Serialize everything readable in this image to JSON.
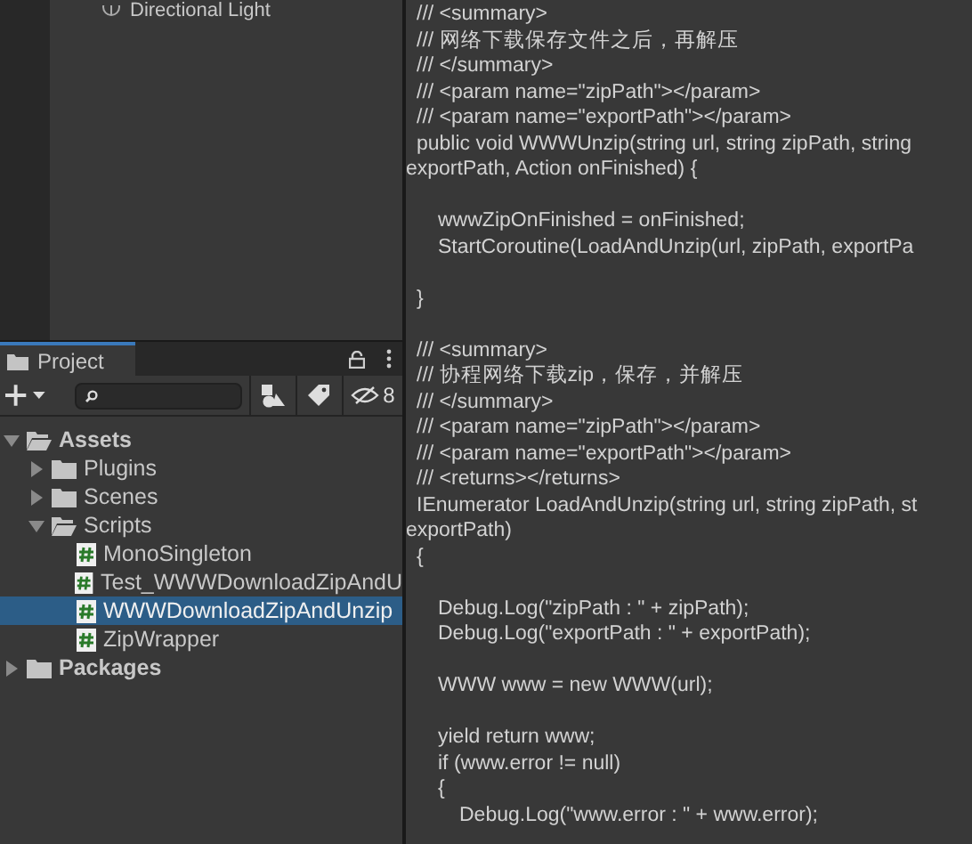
{
  "hierarchy": {
    "items": [
      {
        "label": "Directional Light"
      }
    ]
  },
  "project": {
    "tab": {
      "label": "Project",
      "selected": true
    },
    "hidden_count": "8",
    "tree": [
      {
        "kind": "folder",
        "label": "Assets",
        "expanded": true,
        "selected": false,
        "children": [
          {
            "kind": "folder",
            "label": "Plugins",
            "expanded": false,
            "selected": false
          },
          {
            "kind": "folder",
            "label": "Scenes",
            "expanded": false,
            "selected": false
          },
          {
            "kind": "folder",
            "label": "Scripts",
            "expanded": true,
            "selected": false,
            "children": [
              {
                "kind": "script",
                "label": "MonoSingleton",
                "selected": false
              },
              {
                "kind": "script",
                "label": "Test_WWWDownloadZipAndU",
                "selected": false
              },
              {
                "kind": "script",
                "label": "WWWDownloadZipAndUnzip",
                "selected": true
              },
              {
                "kind": "script",
                "label": "ZipWrapper",
                "selected": false
              }
            ]
          }
        ]
      },
      {
        "kind": "folder",
        "label": "Packages",
        "expanded": false,
        "selected": false
      }
    ]
  },
  "code": {
    "lines": [
      {
        "kind": "outer",
        "text": "/// <summary>"
      },
      {
        "kind": "outer",
        "text": "/// 网络下载保存文件之后，再解压"
      },
      {
        "kind": "outer",
        "text": "/// </summary>"
      },
      {
        "kind": "outer",
        "text": "/// <param name=\"zipPath\"></param>"
      },
      {
        "kind": "outer",
        "text": "/// <param name=\"exportPath\"></param>"
      },
      {
        "kind": "outer",
        "text": "public void WWWUnzip(string url, string zipPath, string"
      },
      {
        "kind": "wrap",
        "text": "exportPath, Action onFinished) {"
      },
      {
        "kind": "blank"
      },
      {
        "kind": "inner",
        "text": "wwwZipOnFinished = onFinished;"
      },
      {
        "kind": "inner",
        "text": "StartCoroutine(LoadAndUnzip(url, zipPath, exportPa"
      },
      {
        "kind": "blank"
      },
      {
        "kind": "outer",
        "text": "}"
      },
      {
        "kind": "blank"
      },
      {
        "kind": "outer",
        "text": "/// <summary>"
      },
      {
        "kind": "outer",
        "text": "/// 协程网络下载zip，保存，并解压"
      },
      {
        "kind": "outer",
        "text": "/// </summary>"
      },
      {
        "kind": "outer",
        "text": "/// <param name=\"zipPath\"></param>"
      },
      {
        "kind": "outer",
        "text": "/// <param name=\"exportPath\"></param>"
      },
      {
        "kind": "outer",
        "text": "/// <returns></returns>"
      },
      {
        "kind": "outer",
        "text": "IEnumerator LoadAndUnzip(string url, string zipPath, st"
      },
      {
        "kind": "wrap",
        "text": "exportPath)"
      },
      {
        "kind": "outer",
        "text": "{"
      },
      {
        "kind": "blank"
      },
      {
        "kind": "inner",
        "text": "Debug.Log(\"zipPath : \" + zipPath);"
      },
      {
        "kind": "inner",
        "text": "Debug.Log(\"exportPath : \" + exportPath);"
      },
      {
        "kind": "blank"
      },
      {
        "kind": "inner",
        "text": "WWW www = new WWW(url);"
      },
      {
        "kind": "blank"
      },
      {
        "kind": "inner",
        "text": "yield return www;"
      },
      {
        "kind": "inner",
        "text": "if (www.error != null)"
      },
      {
        "kind": "inner",
        "text": "{"
      },
      {
        "kind": "deep",
        "text": "Debug.Log(\"www.error : \" + www.error);"
      }
    ]
  }
}
